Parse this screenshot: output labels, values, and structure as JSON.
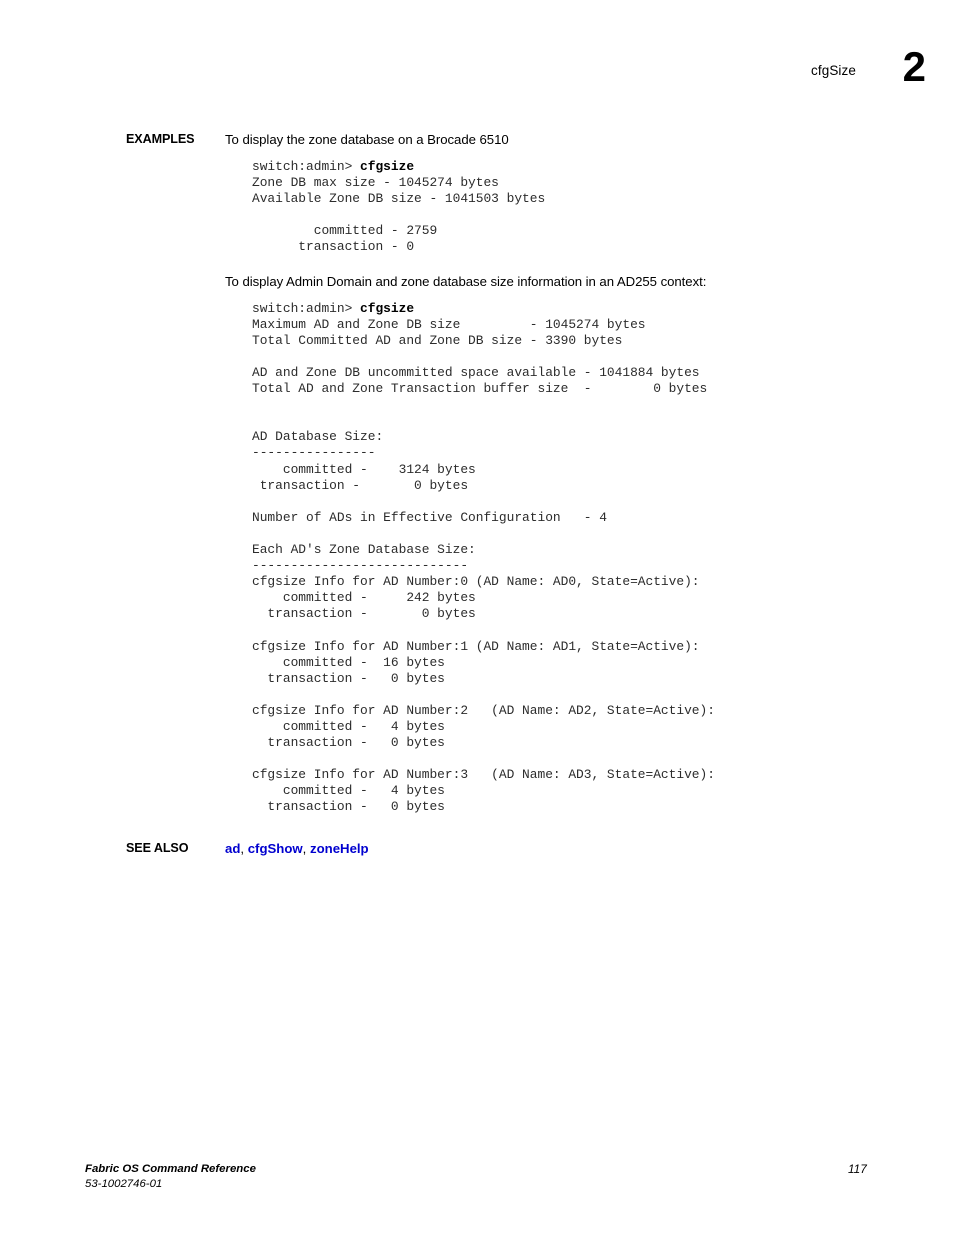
{
  "header": {
    "chapter_title": "cfgSize",
    "chapter_number": "2"
  },
  "sections": {
    "examples": {
      "label": "EXAMPLES",
      "intro_1": "To display the zone database on a Brocade 6510",
      "code_1_prompt": "switch:admin> ",
      "code_1_command": "cfgsize",
      "code_1_output": "\nZone DB max size - 1045274 bytes\nAvailable Zone DB size - 1041503 bytes\n\n        committed - 2759\n      transaction - 0",
      "intro_2": "To display Admin Domain and zone database size information in an AD255 context:",
      "code_2_prompt": "switch:admin> ",
      "code_2_command": "cfgsize",
      "code_2_output": "\nMaximum AD and Zone DB size         - 1045274 bytes\nTotal Committed AD and Zone DB size - 3390 bytes\n\nAD and Zone DB uncommitted space available - 1041884 bytes\nTotal AD and Zone Transaction buffer size  -        0 bytes\n\n\nAD Database Size:\n----------------\n    committed -    3124 bytes\n transaction -       0 bytes\n\nNumber of ADs in Effective Configuration   - 4\n\nEach AD's Zone Database Size:\n----------------------------\ncfgsize Info for AD Number:0 (AD Name: AD0, State=Active):\n    committed -     242 bytes\n  transaction -       0 bytes\n\ncfgsize Info for AD Number:1 (AD Name: AD1, State=Active):\n    committed -  16 bytes\n  transaction -   0 bytes\n\ncfgsize Info for AD Number:2   (AD Name: AD2, State=Active):\n    committed -   4 bytes\n  transaction -   0 bytes\n\ncfgsize Info for AD Number:3   (AD Name: AD3, State=Active):\n    committed -   4 bytes\n  transaction -   0 bytes"
    },
    "see_also": {
      "label": "SEE ALSO",
      "links": [
        "ad",
        "cfgShow",
        "zoneHelp"
      ],
      "separator": ", "
    }
  },
  "footer": {
    "document_title": "Fabric OS Command Reference",
    "document_code": "53-1002746-01",
    "page_number": "117"
  }
}
